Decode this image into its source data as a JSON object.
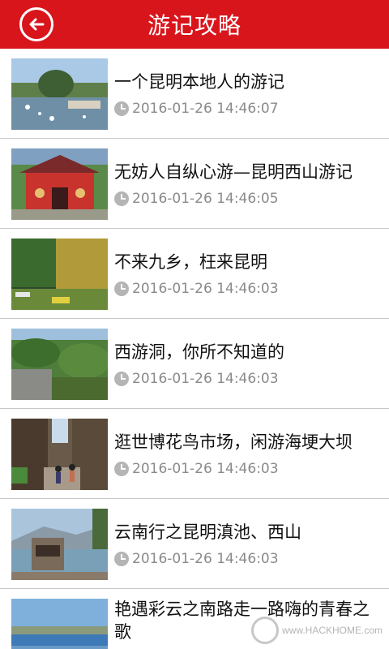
{
  "header": {
    "title": "游记攻略",
    "back_icon": "back-arrow-icon",
    "background_color": "#d9151c"
  },
  "articles": [
    {
      "title": "一个昆明本地人的游记",
      "date": "2016-01-26 14:46:07"
    },
    {
      "title": "无妨人自纵心游—昆明西山游记",
      "date": "2016-01-26 14:46:05"
    },
    {
      "title": "不来九乡，枉来昆明",
      "date": "2016-01-26 14:46:03"
    },
    {
      "title": "西游洞，你所不知道的",
      "date": "2016-01-26 14:46:03"
    },
    {
      "title": "逛世博花鸟市场，闲游海埂大坝",
      "date": "2016-01-26 14:46:03"
    },
    {
      "title": "云南行之昆明滇池、西山",
      "date": "2016-01-26 14:46:03"
    },
    {
      "title": "艳遇彩云之南路走一路嗨的青春之歌",
      "date": ""
    }
  ],
  "watermark": {
    "text": "www.HACKHOME.com"
  }
}
